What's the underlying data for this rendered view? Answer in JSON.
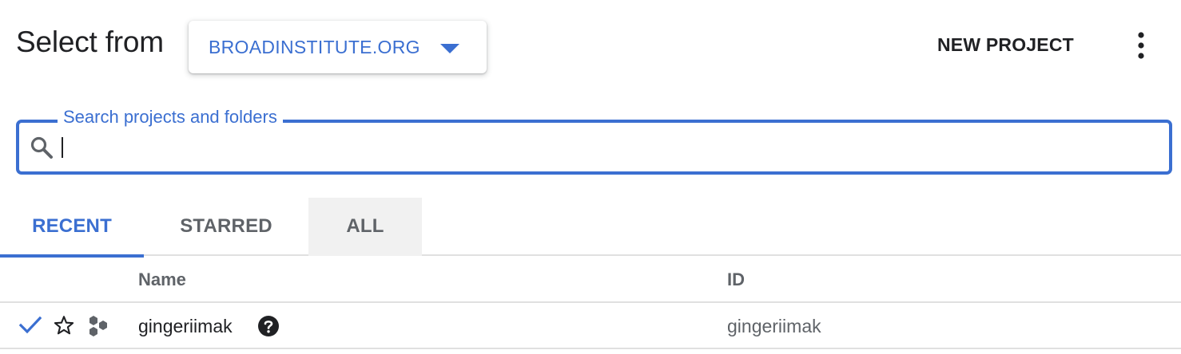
{
  "header": {
    "title": "Select from",
    "organization": "BROADINSTITUTE.ORG",
    "new_project_label": "NEW PROJECT"
  },
  "search": {
    "label": "Search projects and folders",
    "value": "",
    "placeholder": ""
  },
  "tabs": [
    {
      "label": "RECENT",
      "selected": true
    },
    {
      "label": "STARRED",
      "selected": false
    },
    {
      "label": "ALL",
      "selected": false
    }
  ],
  "table": {
    "columns": [
      "Name",
      "ID"
    ],
    "rows": [
      {
        "selected": true,
        "starred": false,
        "name": "gingeriimak",
        "id": "gingeriimak"
      }
    ]
  },
  "icons": {
    "org_dropdown": "caret-down-icon",
    "more": "more-vert-icon",
    "search": "search-icon",
    "selected": "check-icon",
    "star": "star-outline-icon",
    "project": "project-hexagons-icon",
    "help": "help-circle-icon"
  },
  "colors": {
    "accent": "#3b6fd1",
    "text_primary": "#202124",
    "text_secondary": "#5f6368",
    "divider": "#e0e0e0",
    "tab_hover_bg": "#f1f1f1"
  }
}
